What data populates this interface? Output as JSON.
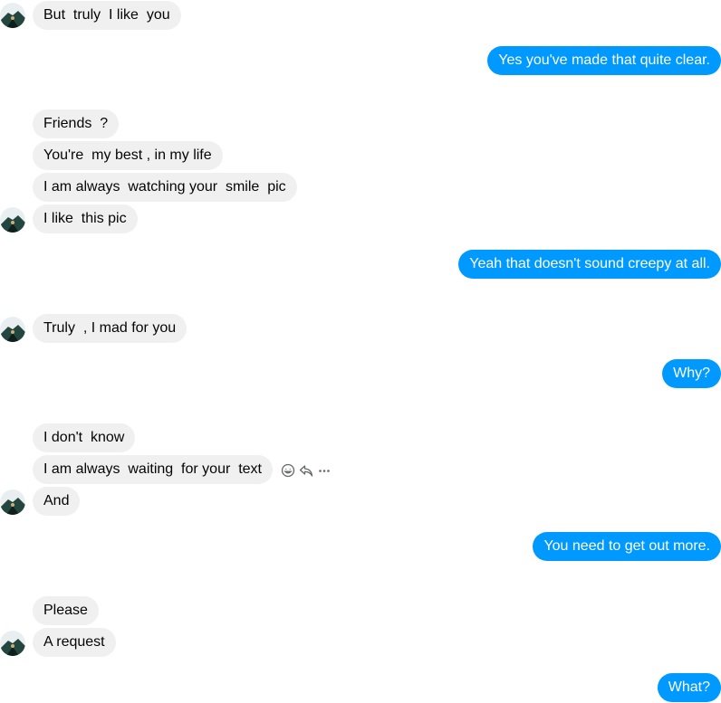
{
  "conversation": {
    "messages": [
      {
        "direction": "incoming",
        "text": "But  truly  I like  you"
      },
      {
        "direction": "outgoing",
        "text": "Yes you've made that quite clear."
      },
      {
        "direction": "incoming",
        "text": "Friends  ?"
      },
      {
        "direction": "incoming",
        "text": "You're  my best , in my life"
      },
      {
        "direction": "incoming",
        "text": "I am always  watching your  smile  pic"
      },
      {
        "direction": "incoming",
        "text": "I like  this pic"
      },
      {
        "direction": "outgoing",
        "text": "Yeah that doesn't sound creepy at all."
      },
      {
        "direction": "incoming",
        "text": "Truly  , I mad for you"
      },
      {
        "direction": "outgoing",
        "text": "Why?"
      },
      {
        "direction": "incoming",
        "text": "I don't  know"
      },
      {
        "direction": "incoming",
        "text": "I am always  waiting  for your  text"
      },
      {
        "direction": "incoming",
        "text": "And"
      },
      {
        "direction": "outgoing",
        "text": "You need to get out more."
      },
      {
        "direction": "incoming",
        "text": "Please"
      },
      {
        "direction": "incoming",
        "text": "A request"
      },
      {
        "direction": "outgoing",
        "text": "What?"
      }
    ],
    "hover_actions": [
      "emoji-react-icon",
      "reply-icon",
      "more-icon"
    ]
  },
  "colors": {
    "incoming_bubble": "#f0f0f0",
    "outgoing_bubble": "#0099ff",
    "incoming_text": "#050505",
    "outgoing_text": "#ffffff",
    "action_icon": "#65676b"
  }
}
